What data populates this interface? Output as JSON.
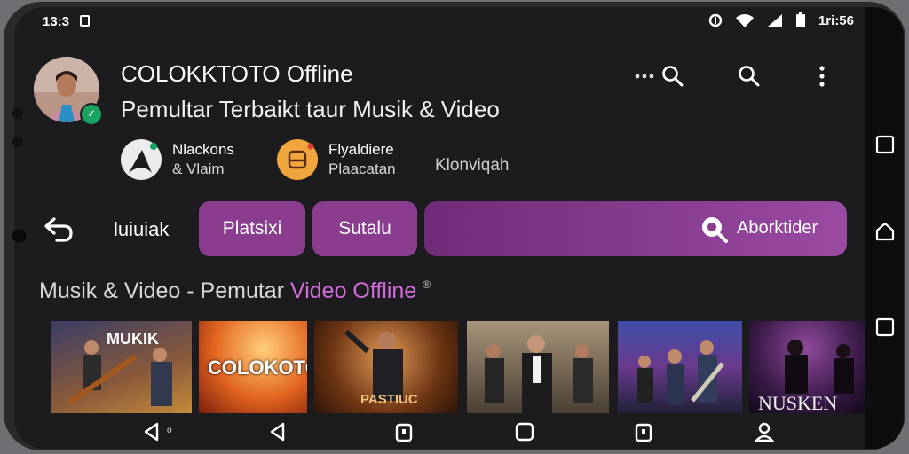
{
  "status": {
    "time": "13:3",
    "battery_text": "1ri:56"
  },
  "header": {
    "title": "COLOKKTOTO Offline",
    "subtitle": "Pemultar Terbaikt taur Musik & Video",
    "icons": [
      "more-horizontal-icon",
      "search-icon",
      "search-icon",
      "more-vertical-icon"
    ]
  },
  "chips": [
    {
      "line1": "Nlackons",
      "line2": "& Vlaim"
    },
    {
      "line1": "Flyaldiere",
      "line2": "Plaacatan"
    },
    {
      "line1": "Klonviqah",
      "line2": ""
    }
  ],
  "nav": {
    "label": "luiuiak",
    "pill1": "Platsixi",
    "pill2": "Sutalu",
    "search_label": "Aborktider"
  },
  "section": {
    "prefix": "Musik & Video - Pemutar ",
    "highlight": "Video Offline",
    "badge": "®"
  },
  "thumbnails": [
    {
      "label": "MUKIK"
    },
    {
      "label": "COLOKOTO"
    },
    {
      "label": "PASTIUC"
    },
    {
      "label": ""
    },
    {
      "label": ""
    },
    {
      "label": "NUSKEN"
    }
  ],
  "colors": {
    "accent": "#8a3c8f",
    "highlight": "#d46bdf",
    "background": "#1c1c1e"
  }
}
